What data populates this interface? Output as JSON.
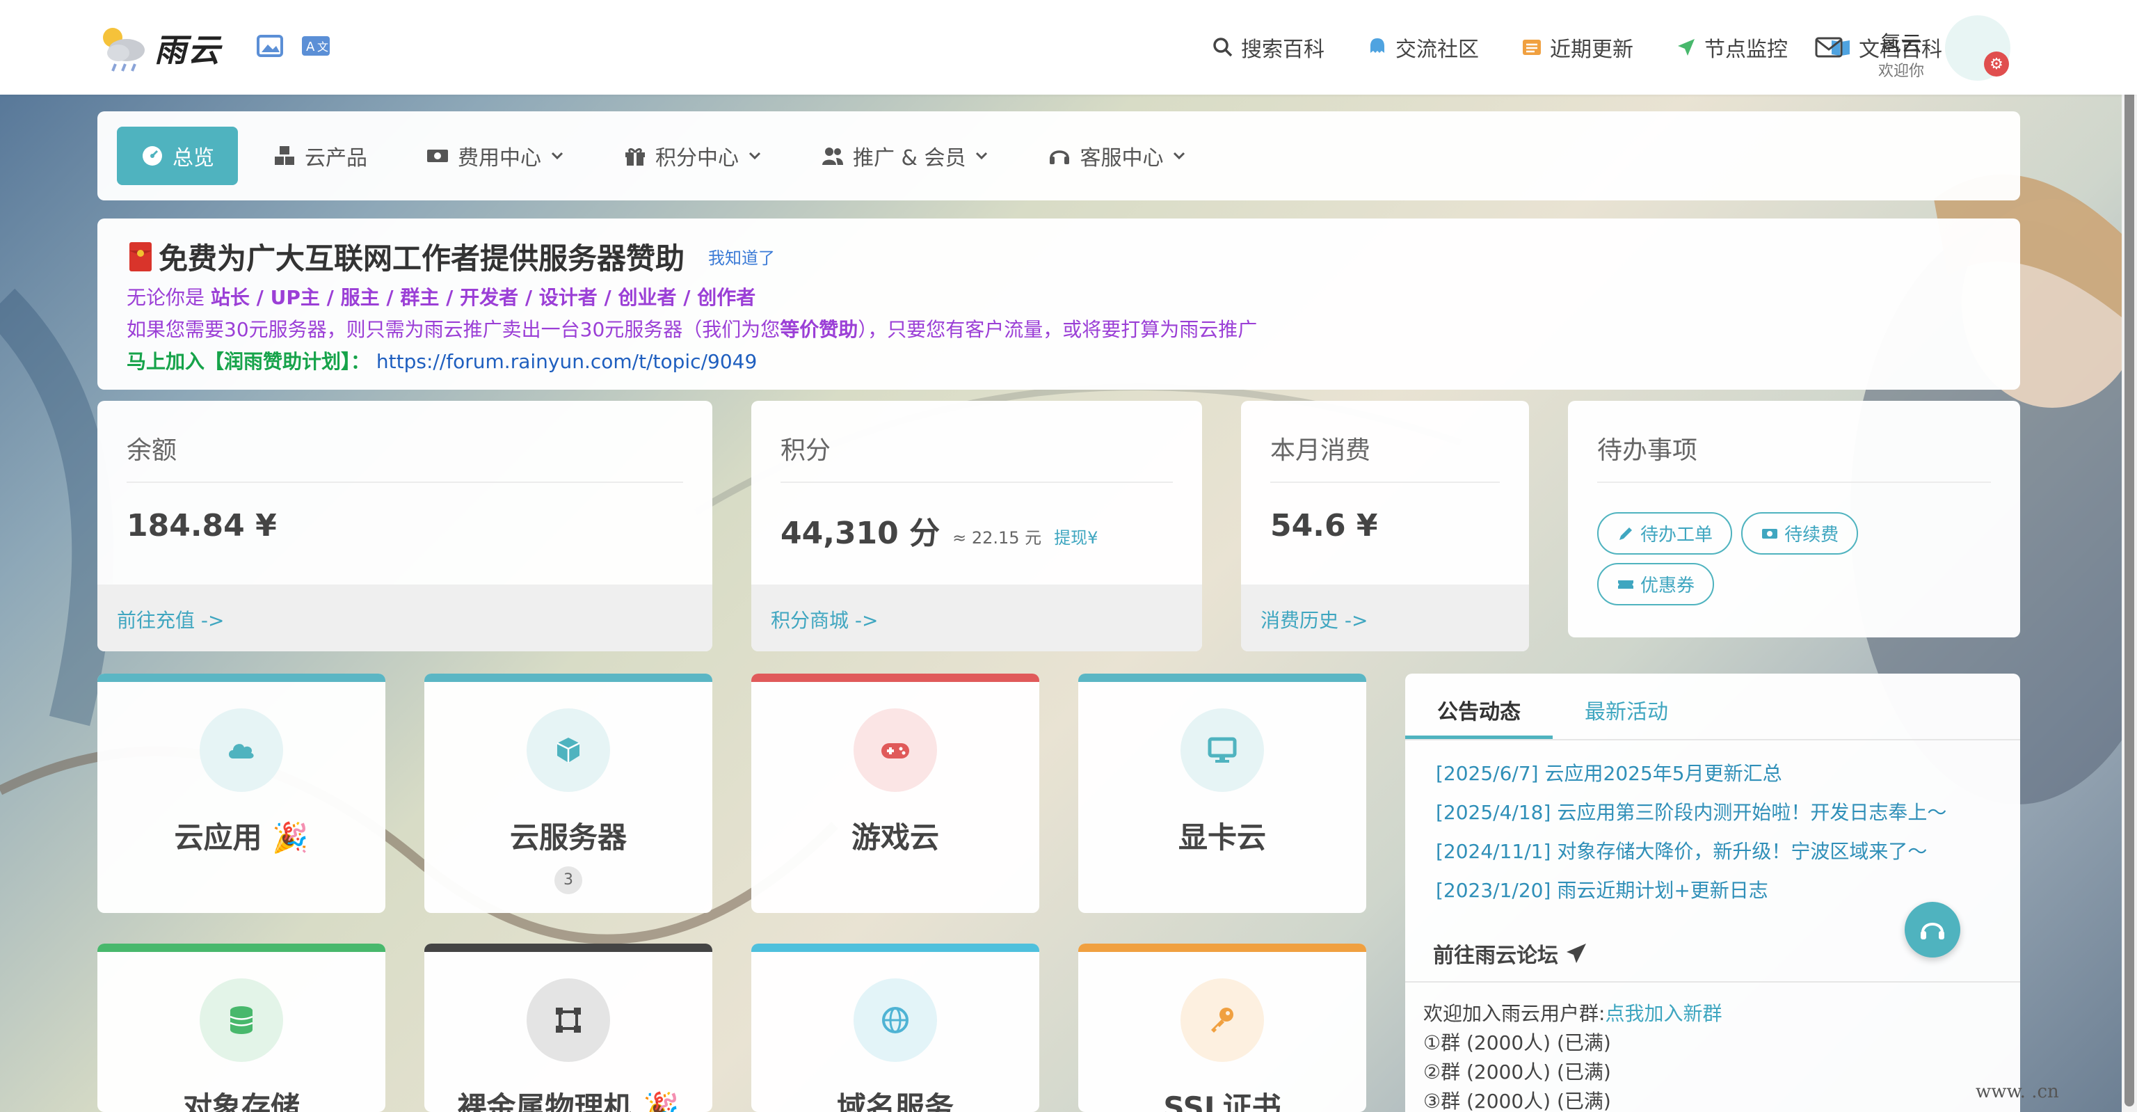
{
  "brand": {
    "name": "雨云"
  },
  "topnav": [
    {
      "label": "搜索百科",
      "icon": "search-icon"
    },
    {
      "label": "交流社区",
      "icon": "chat-bubble-icon"
    },
    {
      "label": "近期更新",
      "icon": "list-icon"
    },
    {
      "label": "节点监控",
      "icon": "send-icon"
    },
    {
      "label": "文档百科",
      "icon": "book-icon"
    }
  ],
  "user": {
    "name": "氢云",
    "greeting": "欢迎你"
  },
  "menu": [
    {
      "label": "总览",
      "active": true
    },
    {
      "label": "云产品"
    },
    {
      "label": "费用中心"
    },
    {
      "label": "积分中心"
    },
    {
      "label": "推广 & 会员"
    },
    {
      "label": "客服中心"
    }
  ],
  "notice": {
    "title": "免费为广大互联网工作者提供服务器赞助",
    "ack": "我知道了",
    "line1_prefix": "无论你是",
    "line1_roles": "站长 / UP主 / 服主 / 群主 / 开发者 / 设计者 / 创业者 / 创作者",
    "line2_a": "如果您需要30元服务器，则只需为雨云推广卖出一台30元服务器（我们为您",
    "line2_b": "等价赞助",
    "line2_c": "），只要您有客户流量，或将要打算为雨云推广",
    "line3_label": "马上加入【润雨赞助计划】：",
    "line3_link": "https://forum.rainyun.com/t/topic/9049"
  },
  "stats": {
    "balance": {
      "title": "余额",
      "value": "184.84 ¥",
      "link": "前往充值 ->"
    },
    "points": {
      "title": "积分",
      "value": "44,310 分",
      "approx": "≈ 22.15 元",
      "withdraw": "提现¥",
      "link": "积分商城 ->"
    },
    "monthly": {
      "title": "本月消费",
      "value": "54.6 ¥",
      "link": "消费历史 ->"
    },
    "todo": {
      "title": "待办事项",
      "items": [
        "待办工单",
        "待续费",
        "优惠券"
      ]
    }
  },
  "tiles": [
    {
      "label": "云应用",
      "color": "#5bb6c4",
      "iconbg": "#e6f4f5",
      "icon": "cloud-icon"
    },
    {
      "label": "云服务器",
      "badge": "3",
      "color": "#5bb6c4",
      "iconbg": "#e6f4f5",
      "icon": "box-icon"
    },
    {
      "label": "游戏云",
      "color": "#e05a5a",
      "iconbg": "#fbe5e5",
      "icon": "gamepad-icon"
    },
    {
      "label": "显卡云",
      "color": "#5bb6c4",
      "iconbg": "#e6f4f5",
      "icon": "monitor-icon"
    },
    {
      "label": "对象存储",
      "color": "#48b86c",
      "iconbg": "#e3f4e8",
      "icon": "database-icon"
    },
    {
      "label": "裸金属物理机",
      "color": "#444444",
      "iconbg": "#e4e4e4",
      "icon": "frame-icon"
    },
    {
      "label": "域名服务",
      "color": "#4fc0dc",
      "iconbg": "#e3f4f8",
      "icon": "globe-icon"
    },
    {
      "label": "SSL证书",
      "color": "#f0a040",
      "iconbg": "#fdf0e0",
      "icon": "key-icon"
    }
  ],
  "news": {
    "tabs": [
      "公告动态",
      "最新活动"
    ],
    "items": [
      "[2025/6/7] 云应用2025年5月更新汇总",
      "[2025/4/18] 云应用第三阶段内测开始啦！开发日志奉上～",
      "[2024/11/1] 对象存储大降价，新升级！宁波区域来了～",
      "[2023/1/20] 雨云近期计划+更新日志"
    ],
    "forum": "前往雨云论坛",
    "group_intro": "欢迎加入雨云用户群:",
    "group_join": "点我加入新群",
    "groups": [
      "①群 (2000人) (已满)",
      "②群 (2000人) (已满)",
      "③群 (2000人) (已满)"
    ]
  },
  "watermark": "www.     .cn",
  "colors": {
    "accent": "#4fb3bf",
    "link": "#3fa6c0",
    "purple": "#9b3fd6",
    "green": "#16a34a"
  }
}
